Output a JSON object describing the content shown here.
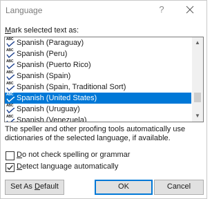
{
  "window": {
    "title": "Language",
    "help_label": "?"
  },
  "list": {
    "label_mnemonic": "M",
    "label_rest": "ark selected text as:",
    "items": [
      "Spanish (Paraguay)",
      "Spanish (Peru)",
      "Spanish (Puerto Rico)",
      "Spanish (Spain)",
      "Spanish (Spain, Traditional Sort)",
      "Spanish (United States)",
      "Spanish (Uruguay)",
      "Spanish (Venezuela)"
    ],
    "selected_index": 5,
    "item_icon": "spelling-check-icon",
    "item_icon_text": "ABC"
  },
  "info_text": "The speller and other proofing tools automatically use dictionaries of the selected language, if available.",
  "options": {
    "no_check": {
      "mnemonic": "D",
      "rest": "o not check spelling or grammar",
      "mnemonic_pos": 0,
      "checked": false
    },
    "detect": {
      "mnemonic": "D",
      "rest": "etect language automatically",
      "checked": true
    }
  },
  "buttons": {
    "set_default": {
      "before": "Set As ",
      "mnemonic": "D",
      "after": "efault"
    },
    "ok": "OK",
    "cancel": "Cancel"
  },
  "colors": {
    "selection": "#0078d7",
    "default_button_border": "#0078d7"
  }
}
